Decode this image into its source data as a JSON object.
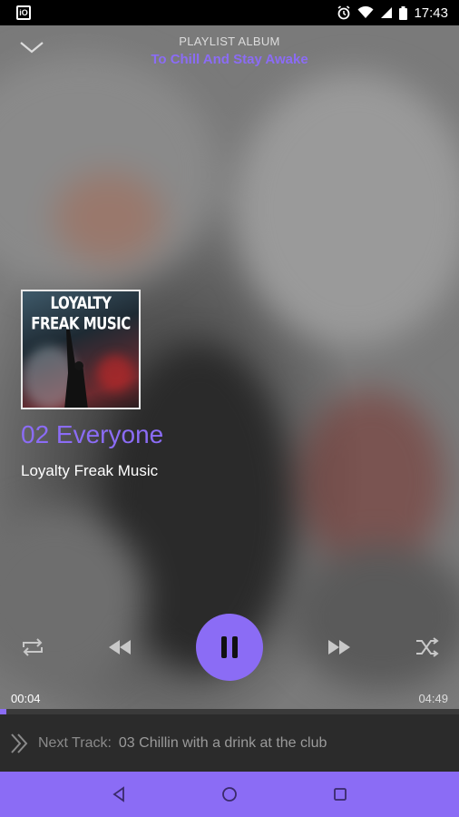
{
  "status_bar": {
    "time": "17:43",
    "icons": [
      "app-badge-icon",
      "alarm-icon",
      "wifi-icon",
      "signal-icon",
      "battery-icon"
    ]
  },
  "header": {
    "label": "PLAYLIST ALBUM",
    "title": "To Chill And Stay Awake"
  },
  "album_art": {
    "text": "LOYALTY FREAK MUSIC"
  },
  "track": {
    "title": "02 Everyone",
    "artist": "Loyalty Freak Music"
  },
  "controls": {
    "buttons": [
      "repeat-icon",
      "rewind-icon",
      "pause-icon",
      "fast-forward-icon",
      "shuffle-icon"
    ]
  },
  "progress": {
    "elapsed": "00:04",
    "total": "04:49",
    "fraction": 0.014
  },
  "next_track": {
    "label": "Next Track:",
    "value": "03 Chillin with a drink at the club"
  },
  "colors": {
    "accent": "#8b6cf5",
    "next_bar_bg": "#2b2b2b",
    "status_bar_bg": "#000000"
  },
  "nav": [
    "back-icon",
    "home-icon",
    "recents-icon"
  ]
}
